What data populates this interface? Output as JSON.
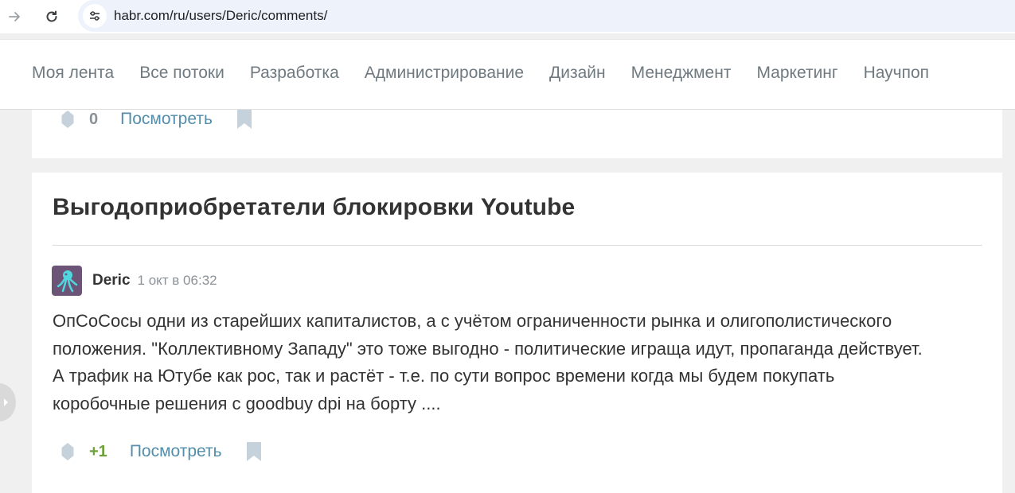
{
  "browser": {
    "url": "habr.com/ru/users/Deric/comments/"
  },
  "nav": {
    "items": [
      {
        "label": "Моя лента"
      },
      {
        "label": "Все потоки"
      },
      {
        "label": "Разработка"
      },
      {
        "label": "Администрирование"
      },
      {
        "label": "Дизайн"
      },
      {
        "label": "Менеджмент"
      },
      {
        "label": "Маркетинг"
      },
      {
        "label": "Научпоп"
      }
    ]
  },
  "prev_comment": {
    "score": "0",
    "view_label": "Посмотреть"
  },
  "comment": {
    "post_title": "Выгодоприобретатели блокировки Youtube",
    "author": "Deric",
    "time": "1 окт в 06:32",
    "lines": [
      "ОпСоСосы одни из старейших капиталистов, а с учётом ограниченности рынка и олигополистического",
      "положения. \"Коллективному Западу\" это тоже выгодно - политические игращa идут, пропаганда действует.",
      "А трафик на Ютубе как рос, так и растёт - т.е. по сути вопрос времени когда мы будем покупать",
      "коробочные решения с goodbuy dpi на борту ...."
    ],
    "score": "+1",
    "view_label": "Посмотреть"
  },
  "colors": {
    "accent_link": "#548eaa",
    "score_positive": "#6ca13c",
    "icon_gray": "#c5d2dc"
  }
}
